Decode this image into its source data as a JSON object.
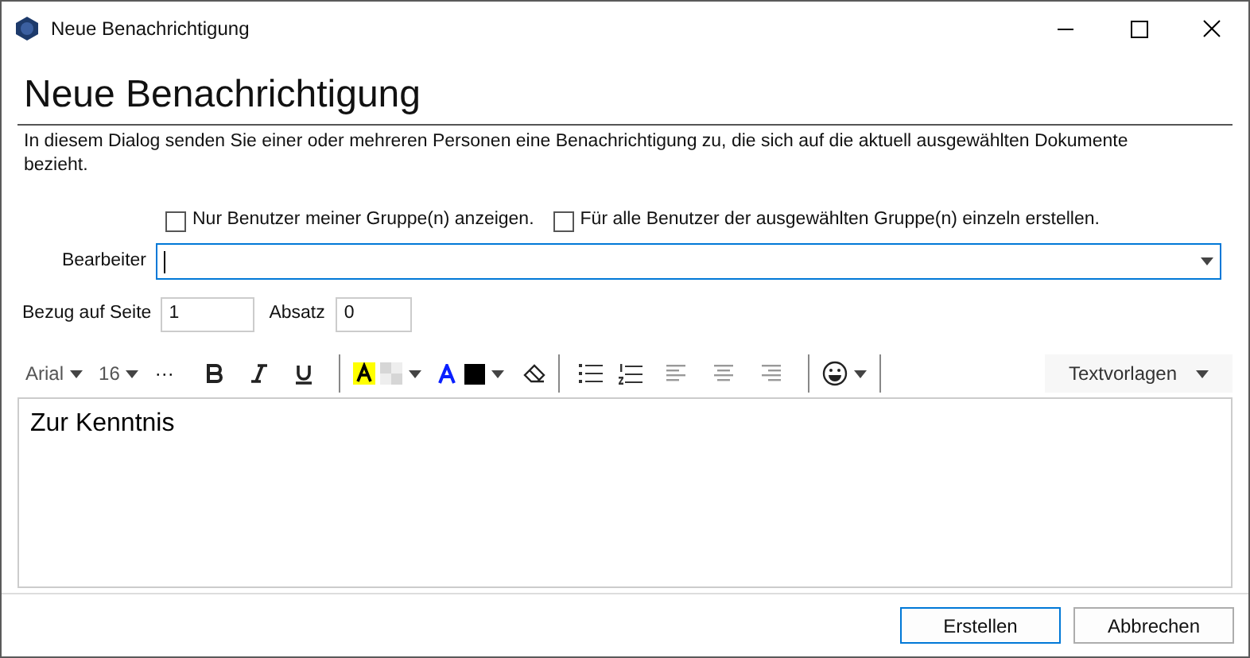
{
  "window": {
    "title": "Neue Benachrichtigung"
  },
  "heading": "Neue Benachrichtigung",
  "description": "In diesem Dialog senden Sie einer oder mehreren Personen eine Benachrichtigung zu, die sich auf die aktuell ausgewählten Dokumente bezieht.",
  "options": [
    {
      "label": "Nur Benutzer meiner Gruppe(n) anzeigen.",
      "checked": false
    },
    {
      "label": "Für alle Benutzer der ausgewählten Gruppe(n) einzeln erstellen.",
      "checked": false
    }
  ],
  "editor_field": {
    "label": "Bearbeiter"
  },
  "page_ref": {
    "label": "Bezug auf Seite",
    "value": "1"
  },
  "paragraph": {
    "label": "Absatz",
    "value": "0"
  },
  "toolbar": {
    "font": "Arial",
    "size": "16",
    "more": "···",
    "templates": "Textvorlagen"
  },
  "body_text": "Zur Kenntnis",
  "buttons": [
    {
      "label": "Erstellen",
      "default": true
    },
    {
      "label": "Abbrechen",
      "default": false
    }
  ]
}
